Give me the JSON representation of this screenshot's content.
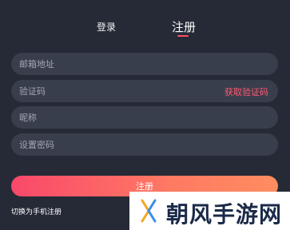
{
  "tabs": {
    "login": "登录",
    "register": "注册"
  },
  "form": {
    "email_placeholder": "邮箱地址",
    "code_placeholder": "验证码",
    "get_code": "获取验证码",
    "nickname_placeholder": "昵称",
    "password_placeholder": "设置密码",
    "submit": "注册"
  },
  "links": {
    "switch_phone": "切换为手机注册"
  },
  "watermark": {
    "text": "朝风手游网"
  },
  "colors": {
    "background": "#252a36",
    "field": "#393e4c",
    "accent": "#ff4f6a",
    "gradient_start": "#f9486a",
    "gradient_end": "#ff8d5f"
  }
}
